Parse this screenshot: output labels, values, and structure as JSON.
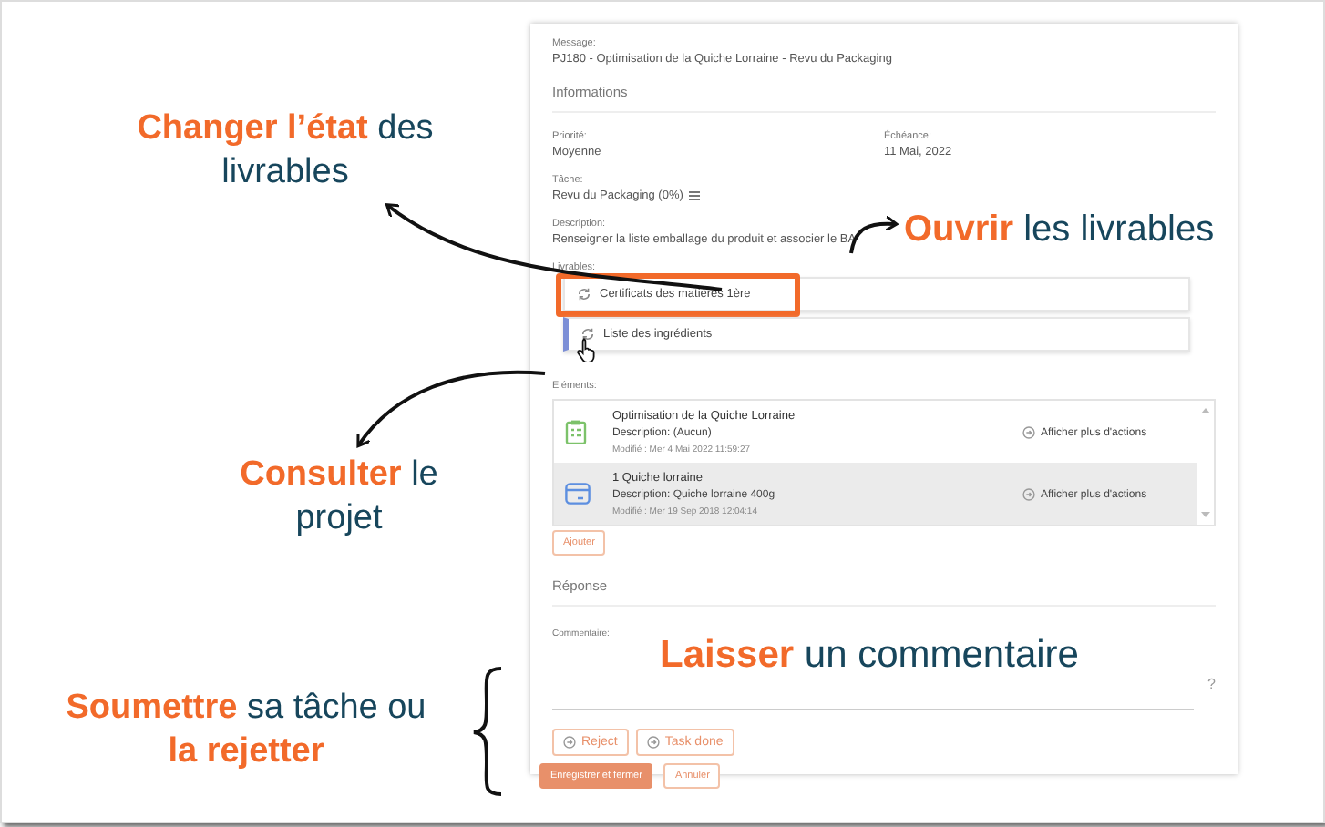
{
  "message": {
    "label": "Message:",
    "value": "PJ180 - Optimisation de la Quiche Lorraine - Revu du Packaging"
  },
  "informations_heading": "Informations",
  "priority": {
    "label": "Priorité:",
    "value": "Moyenne"
  },
  "due": {
    "label": "Échéance:",
    "value": "11 Mai, 2022"
  },
  "task": {
    "label": "Tâche:",
    "value": "Revu du Packaging (0%)"
  },
  "description": {
    "label": "Description:",
    "value": "Renseigner la liste emballage du produit et associer le BA"
  },
  "deliverables": {
    "label": "Livrables:",
    "items": [
      {
        "name": "Certificats des matières 1ère",
        "highlighted": true,
        "hovered": false
      },
      {
        "name": "Liste des ingrédients",
        "highlighted": false,
        "hovered": true
      }
    ]
  },
  "elements": {
    "label": "Eléments:",
    "items": [
      {
        "kind": "checklist",
        "title": "Optimisation de la Quiche Lorraine",
        "description": "Description: (Aucun)",
        "modified": "Modifié : Mer 4 Mai 2022 11:59:27",
        "action": "Afficher plus d'actions",
        "selected": false
      },
      {
        "kind": "box",
        "title": "1 Quiche lorraine",
        "description": "Description: Quiche lorraine 400g",
        "modified": "Modifié : Mer 19 Sep 2018 12:04:14",
        "action": "Afficher plus d'actions",
        "selected": true
      }
    ]
  },
  "add_button": "Ajouter",
  "response_heading": "Réponse",
  "comment": {
    "label": "Commentaire:",
    "help": "?"
  },
  "actions": [
    "Reject",
    "Task done"
  ],
  "footer_buttons": [
    {
      "label": "Enregistrer et fermer",
      "kind": "primary"
    },
    {
      "label": "Annuler",
      "kind": "secondary"
    }
  ],
  "annotations": [
    {
      "text": "**Changer l’état** des livrables"
    },
    {
      "text": "**Ouvrir** les livrables"
    },
    {
      "text": "**Consulter** le projet"
    },
    {
      "text": "**Laisser** un commentaire"
    },
    {
      "text": "**Soumettre** sa tâche ou **la rejetter**"
    }
  ]
}
